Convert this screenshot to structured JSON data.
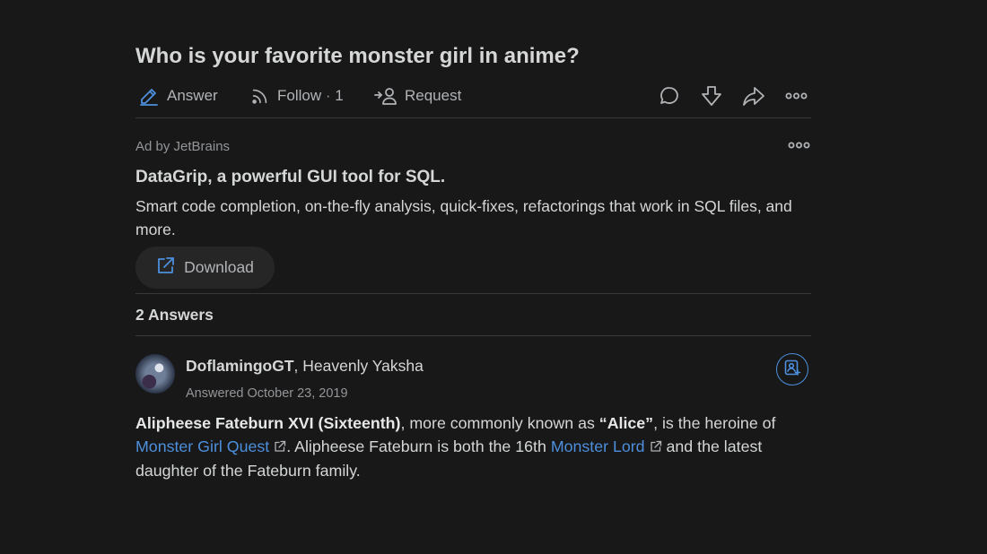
{
  "question": {
    "title": "Who is your favorite monster girl in anime?"
  },
  "actions": {
    "answer_label": "Answer",
    "follow_label": "Follow",
    "follow_sep": "·",
    "follow_count": "1",
    "request_label": "Request"
  },
  "ad": {
    "by": "Ad by JetBrains",
    "title": "DataGrip, a powerful GUI tool for SQL.",
    "description": "Smart code completion, on-the-fly analysis, quick-fixes, refactorings that work in SQL files, and more.",
    "cta_label": "Download"
  },
  "answers": {
    "count_label": "2 Answers",
    "items": [
      {
        "author_name": "DoflamingoGT",
        "author_sep": ",",
        "author_credential": "Heavenly Yaksha",
        "answered": "Answered October 23, 2019",
        "body": {
          "bold1": "Alipheese Fateburn XVI (Sixteenth)",
          "t1": ", more commonly known as ",
          "bold2": "“Alice”",
          "t2": ", is the heroine of ",
          "link1": "Monster Girl Quest",
          "t3": ". Alipheese Fateburn is both the 16th ",
          "link2": "Monster Lord",
          "t4": " and the latest daughter of the Fateburn family."
        }
      }
    ]
  },
  "colors": {
    "background": "#181818",
    "text": "#d5d6d6",
    "muted": "#939598",
    "link": "#4d8fdd",
    "divider": "#393839",
    "button_bg": "#262626"
  },
  "icons": {
    "answer": "pencil-edit-icon",
    "follow": "rss-feed-icon",
    "request": "person-add-arrow-icon",
    "comment": "comment-bubble-icon",
    "downvote": "downvote-arrow-icon",
    "share": "share-arrow-icon",
    "more": "more-dots-icon",
    "external": "external-link-icon",
    "follow_user": "follow-user-icon"
  }
}
